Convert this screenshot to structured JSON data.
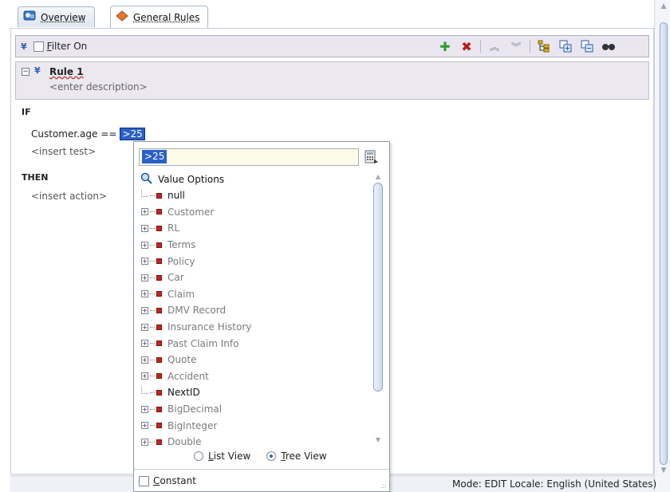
{
  "tabs": [
    {
      "label": "Overview",
      "icon": "overview-icon",
      "active": false
    },
    {
      "label": "General Rules",
      "icon": "rules-diamond-icon",
      "active": true
    }
  ],
  "toolbar": {
    "filter_label": "Filter On",
    "icons": [
      "add-icon",
      "delete-icon",
      "move-up-icon",
      "move-down-icon",
      "tree-icon",
      "expand-all-icon",
      "collapse-all-icon",
      "glasses-icon"
    ]
  },
  "rule": {
    "title": "Rule 1",
    "description": "<enter description>"
  },
  "editor": {
    "if_label": "IF",
    "condition_left": "Customer.age",
    "condition_op": "==",
    "condition_value": ">25",
    "insert_test": "<insert test>",
    "then_label": "THEN",
    "insert_action": "<insert action>"
  },
  "popup": {
    "input_value": ">25",
    "root_label": "Value Options",
    "items": [
      {
        "label": "null",
        "expandable": false,
        "style": "dark"
      },
      {
        "label": "Customer",
        "expandable": true,
        "style": "gray"
      },
      {
        "label": "RL",
        "expandable": true,
        "style": "gray"
      },
      {
        "label": "Terms",
        "expandable": true,
        "style": "gray"
      },
      {
        "label": "Policy",
        "expandable": true,
        "style": "gray"
      },
      {
        "label": "Car",
        "expandable": true,
        "style": "gray"
      },
      {
        "label": "Claim",
        "expandable": true,
        "style": "gray"
      },
      {
        "label": "DMV Record",
        "expandable": true,
        "style": "gray"
      },
      {
        "label": "Insurance History",
        "expandable": true,
        "style": "gray"
      },
      {
        "label": "Past Claim Info",
        "expandable": true,
        "style": "gray"
      },
      {
        "label": "Quote",
        "expandable": true,
        "style": "gray"
      },
      {
        "label": "Accident",
        "expandable": true,
        "style": "gray"
      },
      {
        "label": "NextID",
        "expandable": false,
        "style": "dark"
      },
      {
        "label": "BigDecimal",
        "expandable": true,
        "style": "gray"
      },
      {
        "label": "BigInteger",
        "expandable": true,
        "style": "gray"
      },
      {
        "label": "Double",
        "expandable": true,
        "style": "gray"
      }
    ],
    "list_view_label": "List View",
    "tree_view_label": "Tree View",
    "selected_view": "Tree View",
    "constant_label": "Constant"
  },
  "status": {
    "text": "Mode: EDIT   Locale: English (United States)"
  },
  "colors": {
    "selection": "#2b61c7",
    "toolbar_bg": "#e9e6ef",
    "node_red": "#c42424"
  }
}
